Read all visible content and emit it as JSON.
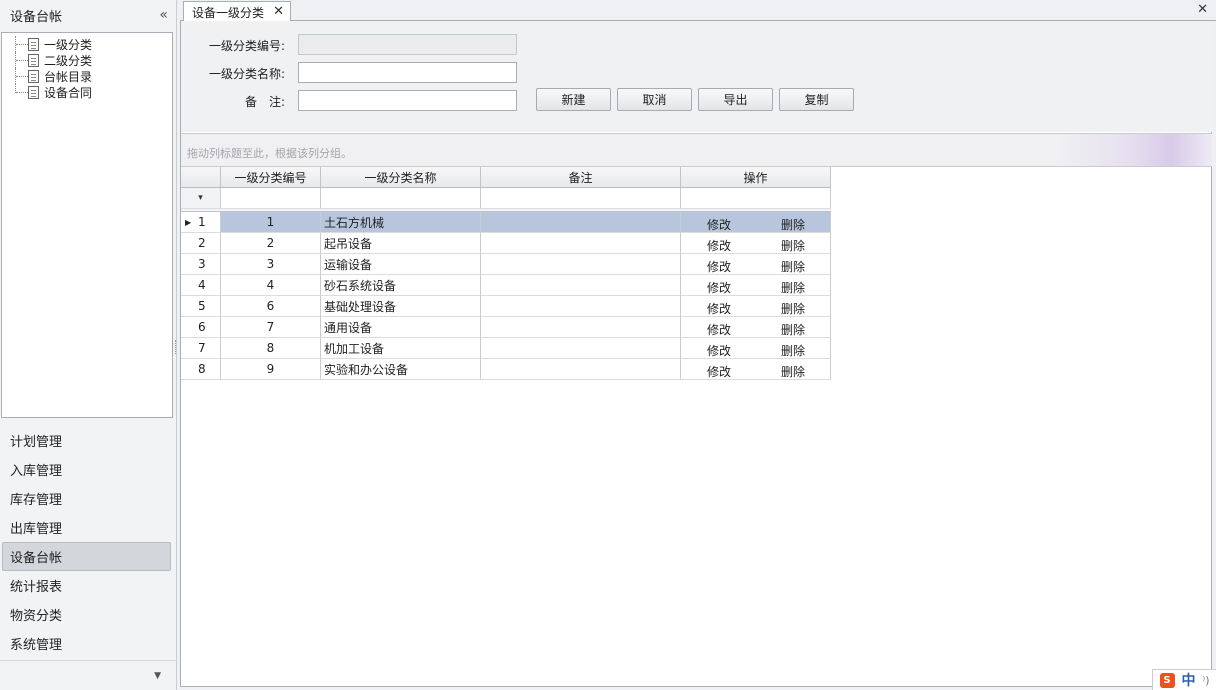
{
  "sidebar": {
    "title": "设备台帐",
    "collapse_glyph": "«",
    "tree": [
      {
        "label": "一级分类"
      },
      {
        "label": "二级分类"
      },
      {
        "label": "台帐目录"
      },
      {
        "label": "设备合同"
      }
    ],
    "nav": [
      {
        "label": "计划管理",
        "active": false
      },
      {
        "label": "入库管理",
        "active": false
      },
      {
        "label": "库存管理",
        "active": false
      },
      {
        "label": "出库管理",
        "active": false
      },
      {
        "label": "设备台帐",
        "active": true
      },
      {
        "label": "统计报表",
        "active": false
      },
      {
        "label": "物资分类",
        "active": false
      },
      {
        "label": "系统管理",
        "active": false
      }
    ]
  },
  "tab": {
    "title": "设备一级分类",
    "close_glyph": "✕"
  },
  "window_close_glyph": "✕",
  "form": {
    "code_label": "一级分类编号:",
    "code_value": "",
    "name_label": "一级分类名称:",
    "name_value": "",
    "note_label": "备　注:",
    "note_value": ""
  },
  "buttons": {
    "new": "新建",
    "cancel": "取消",
    "export": "导出",
    "copy": "复制"
  },
  "group_panel_hint": "拖动列标题至此，根据该列分组。",
  "grid": {
    "columns": [
      "一级分类编号",
      "一级分类名称",
      "备注",
      "操作"
    ],
    "filter_glyph": "▾",
    "row_arrow": "▶",
    "edit_label": "修改",
    "delete_label": "删除",
    "rows": [
      {
        "num": "1",
        "code": "1",
        "name": "土石方机械",
        "note": "",
        "selected": true
      },
      {
        "num": "2",
        "code": "2",
        "name": "起吊设备",
        "note": "",
        "selected": false
      },
      {
        "num": "3",
        "code": "3",
        "name": "运输设备",
        "note": "",
        "selected": false
      },
      {
        "num": "4",
        "code": "4",
        "name": "砂石系统设备",
        "note": "",
        "selected": false
      },
      {
        "num": "5",
        "code": "6",
        "name": "基础处理设备",
        "note": "",
        "selected": false
      },
      {
        "num": "6",
        "code": "7",
        "name": "通用设备",
        "note": "",
        "selected": false
      },
      {
        "num": "7",
        "code": "8",
        "name": "机加工设备",
        "note": "",
        "selected": false
      },
      {
        "num": "8",
        "code": "9",
        "name": "实验和办公设备",
        "note": "",
        "selected": false
      }
    ]
  },
  "ime": {
    "logo": "S",
    "mode": "中",
    "extra": "⁾)"
  }
}
